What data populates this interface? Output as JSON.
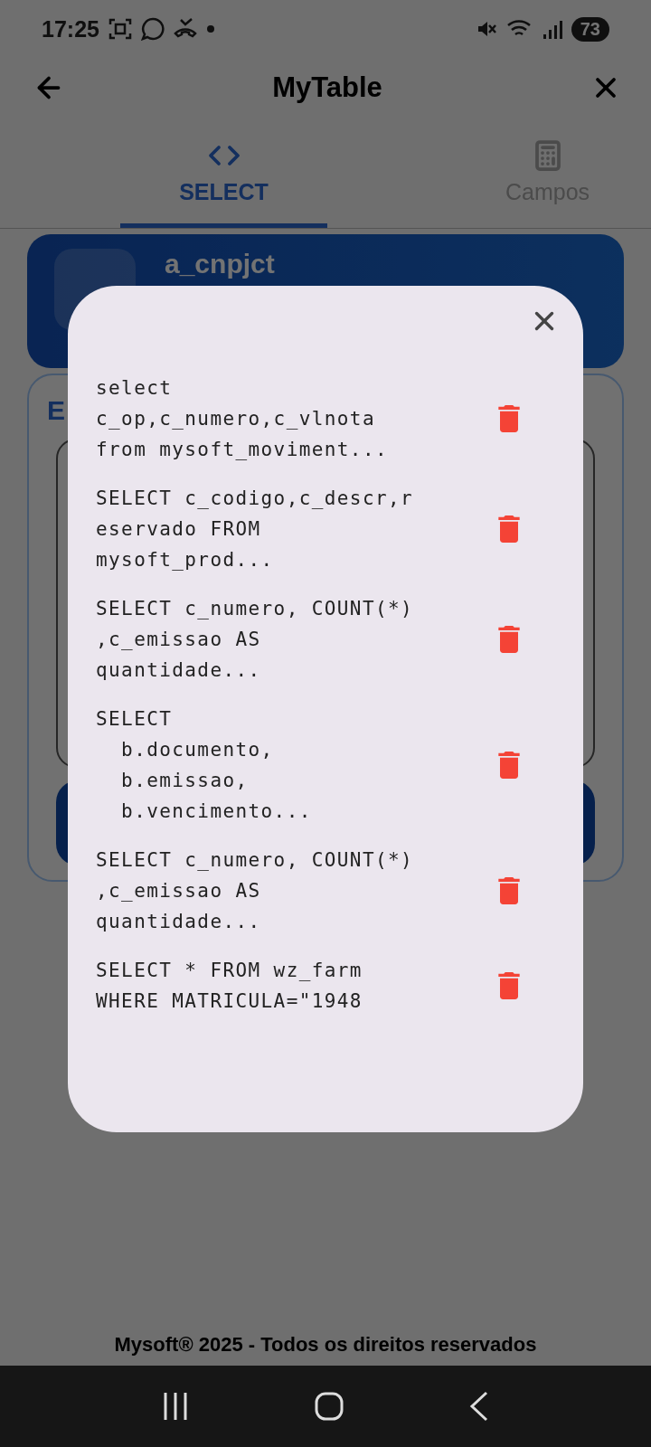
{
  "status_bar": {
    "time": "17:25",
    "battery": "73"
  },
  "app_bar": {
    "title": "MyTable"
  },
  "tabs": [
    {
      "label": "SELECT",
      "selected": true
    },
    {
      "label": "Campos",
      "selected": false
    }
  ],
  "table_card": {
    "name": "a_cnpjct"
  },
  "editor_card": {
    "heading": "E"
  },
  "history_dialog": {
    "queries": [
      {
        "text": "select\nc_op,c_numero,c_vlnota\nfrom mysoft_moviment..."
      },
      {
        "text": "SELECT c_codigo,c_descr,r\neservado FROM\nmysoft_prod..."
      },
      {
        "text": "SELECT c_numero, COUNT(*)\n,c_emissao AS\nquantidade..."
      },
      {
        "text": "SELECT\n  b.documento,\n  b.emissao,\n  b.vencimento..."
      },
      {
        "text": "SELECT c_numero, COUNT(*)\n,c_emissao AS\nquantidade..."
      },
      {
        "text": "SELECT * FROM wz_farm\nWHERE MATRICULA=\"1948"
      }
    ]
  },
  "footer": {
    "text": "Mysoft® 2025 - Todos os direitos reservados"
  }
}
